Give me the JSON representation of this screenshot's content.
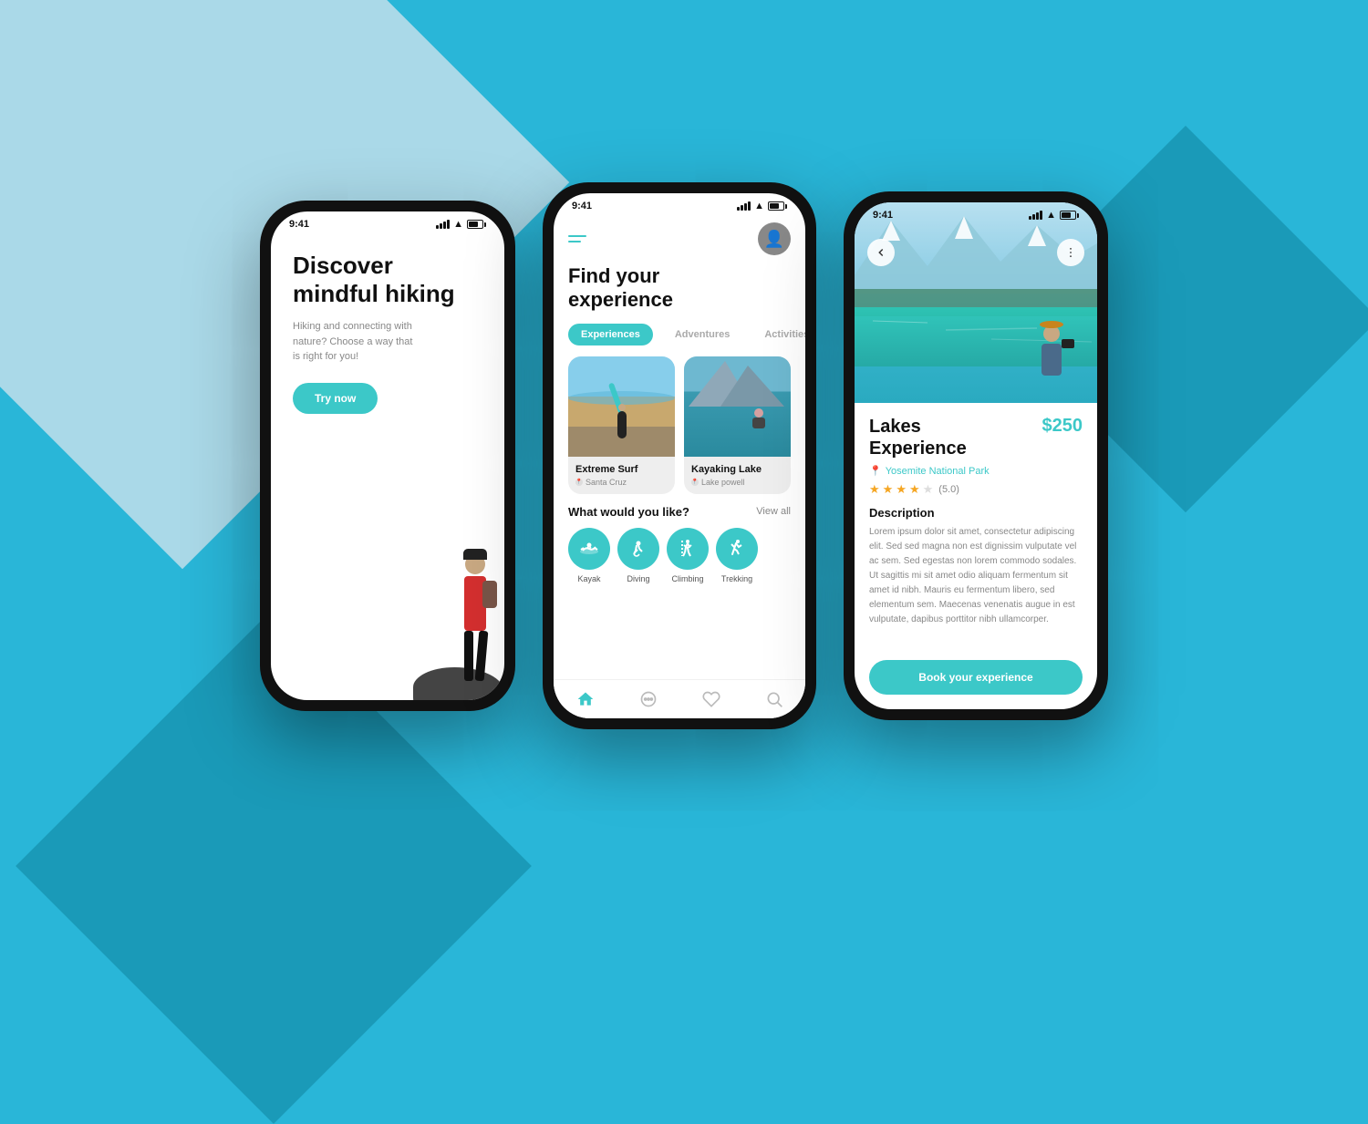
{
  "background": {
    "color": "#29b6d8"
  },
  "phone1": {
    "status_time": "9:41",
    "title_line1": "Discover",
    "title_line2": "mindful hiking",
    "subtitle": "Hiking and connecting with nature? Choose a way that is right for you!",
    "cta_button": "Try now"
  },
  "phone2": {
    "status_time": "9:41",
    "heading_line1": "Find your",
    "heading_line2": "experience",
    "tabs": [
      {
        "label": "Experiences",
        "active": true
      },
      {
        "label": "Adventures",
        "active": false
      },
      {
        "label": "Activities",
        "active": false
      }
    ],
    "cards": [
      {
        "title": "Extreme Surf",
        "location": "Santa Cruz",
        "type": "beach"
      },
      {
        "title": "Kayaking Lake",
        "location": "Lake powell",
        "type": "lake"
      }
    ],
    "section_title": "What would you like?",
    "view_all": "View all",
    "activities": [
      {
        "label": "Kayak",
        "icon": "🚣"
      },
      {
        "label": "Diving",
        "icon": "🤿"
      },
      {
        "label": "Climbing",
        "icon": "🧗"
      },
      {
        "label": "Trekking",
        "icon": "🥾"
      }
    ],
    "nav_items": [
      "home",
      "chat",
      "heart",
      "search"
    ]
  },
  "phone3": {
    "status_time": "9:41",
    "title": "Lakes\nExperience",
    "title_line1": "Lakes",
    "title_line2": "Experience",
    "price": "$250",
    "location": "Yosemite National Park",
    "rating": 5.0,
    "rating_display": "(5.0)",
    "stars_filled": 4,
    "stars_half": 0,
    "stars_empty": 1,
    "description_title": "Description",
    "description": "Lorem ipsum dolor sit amet, consectetur adipiscing elit. Sed sed magna non est dignissim vulputate vel ac sem. Sed egestas non lorem commodo sodales. Ut sagittis mi sit amet odio aliquam fermentum sit amet id nibh. Mauris eu fermentum libero, sed elementum sem. Maecenas venenatis augue in est vulputate, dapibus porttitor nibh ullamcorper.",
    "book_button": "Book your experience"
  }
}
